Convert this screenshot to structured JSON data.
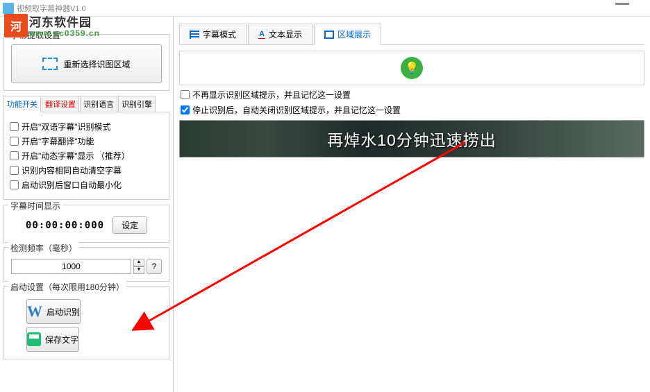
{
  "title_bar": {
    "title": "视频取字幕神器V1.0"
  },
  "watermark": {
    "brand": "河东软件园",
    "url": "www.pc0359.cn"
  },
  "left": {
    "group_extract_title": "字幕提取设置",
    "reselect_label": "重新选择识图区域",
    "tabs": {
      "t1": "功能开关",
      "t2": "翻译设置",
      "t3": "识别语言",
      "t4": "识别引擎"
    },
    "checks": {
      "c1": "开启\"双语字幕\"识别模式",
      "c2": "开启\"字幕翻译\"功能",
      "c3": "开启\"动态字幕\"显示  （推荐）",
      "c4": "识别内容相同自动清空字幕",
      "c5": "启动识别后窗口自动最小化"
    },
    "time_group_title": "字幕时间显示",
    "time_value": "00:00:00:000",
    "time_set_btn": "设定",
    "freq_group_title": "检测频率（毫秒）",
    "freq_value": "1000",
    "help_label": "?",
    "startup_group_title": "启动设置（每次限用180分钟）",
    "start_btn": "启动识别",
    "save_btn": "保存文字"
  },
  "right": {
    "tabs": {
      "subtitle_mode": "字幕模式",
      "text_display": "文本显示",
      "region_display": "区域展示"
    },
    "checks": {
      "r1": "不再显示识别区域提示，并且记忆这一设置",
      "r2": "停止识别后，自动关闭识别区域提示，并且记忆这一设置"
    },
    "video_subtitle": "再焯水10分钟迅速捞出"
  }
}
